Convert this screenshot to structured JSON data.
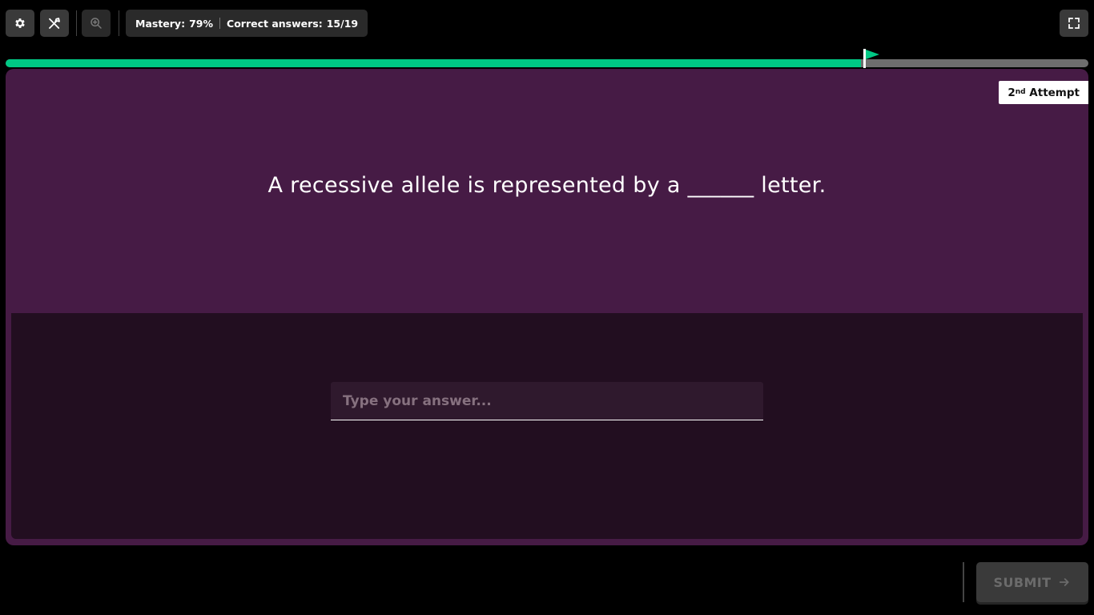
{
  "toolbar": {
    "buttons": [
      {
        "name": "settings",
        "icon": "gear-icon"
      },
      {
        "name": "power-up",
        "icon": "power-up-icon"
      },
      {
        "name": "zoom",
        "icon": "zoom-in-icon"
      }
    ],
    "stats": {
      "mastery_label": "Mastery:",
      "mastery_value": "79%",
      "correct_label": "Correct answers:",
      "correct_value": "15/19"
    },
    "fullscreen_icon": "fullscreen-icon"
  },
  "progress": {
    "fraction": 0.79,
    "fill_color": "#00c985",
    "track_color": "#6e6e6e",
    "flag_icon": "flag-icon"
  },
  "question": {
    "attempt_number": "2",
    "attempt_suffix": "nd",
    "attempt_label": "Attempt",
    "text": "A recessive allele is represented by a ______ letter.",
    "background_color": "#461b45"
  },
  "answer": {
    "placeholder": "Type your answer...",
    "value": ""
  },
  "footer": {
    "submit_label": "SUBMIT",
    "submit_icon": "arrow-right-icon"
  },
  "colors": {
    "accent": "#00c985",
    "answer_panel": "#220e20"
  }
}
